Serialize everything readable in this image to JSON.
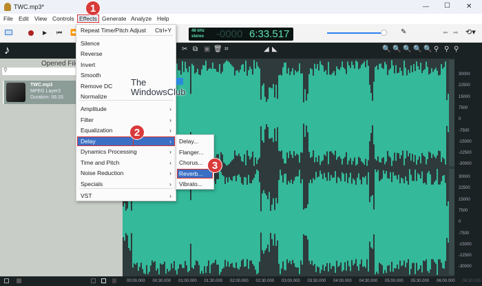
{
  "window": {
    "title": "TWC.mp3*",
    "minimize": "—",
    "maximize": "☐",
    "close": "✕"
  },
  "menubar": [
    "File",
    "Edit",
    "View",
    "Controls",
    "Effects",
    "Generate",
    "Analyze",
    "Help"
  ],
  "lcd": {
    "rate": "48 kHz",
    "channels": "stereo",
    "time_dim": "-0000",
    "time": "6:33.517"
  },
  "volume_fraction": 0.96,
  "left_panel": {
    "title": "Opened File",
    "search_placeholder": "",
    "file": {
      "name": "TWC.mp3",
      "format": "MPEG Layer3",
      "duration": "Duration: 06:33"
    }
  },
  "watermark": {
    "line1": "The",
    "line2": "WindowsClub"
  },
  "effects_menu": {
    "items": [
      {
        "label": "Repeat Time/Pitch Adjust",
        "shortcut": "Ctrl+Y"
      },
      {
        "label": "Silence"
      },
      {
        "label": "Reverse"
      },
      {
        "label": "Invert"
      },
      {
        "label": "Smooth"
      },
      {
        "label": "Remove DC"
      },
      {
        "label": "Normalize"
      },
      {
        "label": "Amplitude",
        "sub": true
      },
      {
        "label": "Filter",
        "sub": true
      },
      {
        "label": "Equalization",
        "sub": true
      },
      {
        "label": "Delay",
        "sub": true,
        "active": true
      },
      {
        "label": "Dynamics Processing",
        "sub": true
      },
      {
        "label": "Time and Pitch",
        "sub": true
      },
      {
        "label": "Noise Reduction",
        "sub": true
      },
      {
        "label": "Specials",
        "sub": true
      },
      {
        "label": "VST",
        "sub": true
      }
    ]
  },
  "delay_submenu": [
    "Delay...",
    "Flanger...",
    "Chorus...",
    "Reverb...",
    "Vibrato..."
  ],
  "badges": [
    "1",
    "2",
    "3"
  ],
  "scale_labels": [
    "30000",
    "22500",
    "15000",
    "7500",
    "0",
    "-7500",
    "-15000",
    "-22500",
    "-30000"
  ],
  "timeline": [
    "00:00.000",
    "00:30.000",
    "01:00.000",
    "01:30.000",
    "02:00.000",
    "02:30.000",
    "03:00.000",
    "03:30.000",
    "04:00.000",
    "04:30.000",
    "05:00.000",
    "05:30.000",
    "06:00.000",
    "06:30.000"
  ],
  "colors": {
    "wave": "#34b99a",
    "accent": "#3a6fc4",
    "badge": "#d93a3a"
  }
}
